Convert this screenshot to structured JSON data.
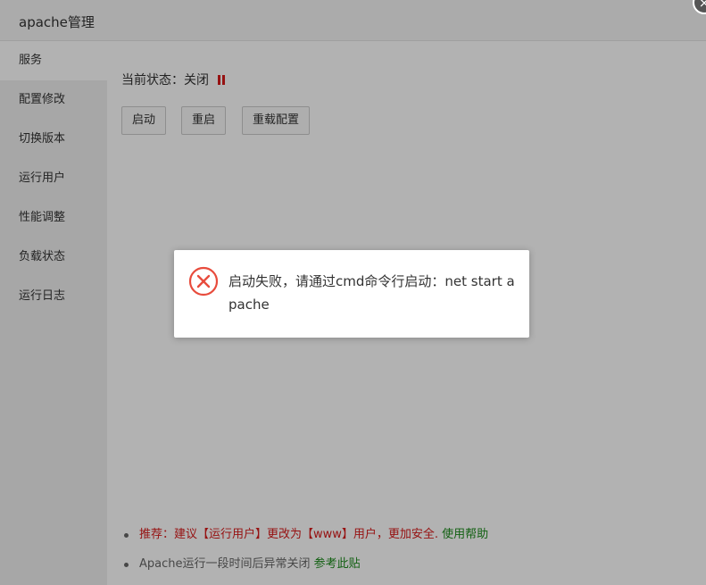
{
  "window": {
    "title": "apache管理",
    "close_symbol": "×"
  },
  "sidebar": {
    "items": [
      {
        "label": "服务",
        "active": true
      },
      {
        "label": "配置修改"
      },
      {
        "label": "切换版本"
      },
      {
        "label": "运行用户"
      },
      {
        "label": "性能调整"
      },
      {
        "label": "负载状态"
      },
      {
        "label": "运行日志"
      }
    ]
  },
  "status": {
    "label": "当前状态：",
    "value": "关闭",
    "icon": "pause-icon",
    "icon_color": "#d71b1b"
  },
  "buttons": {
    "start": "启动",
    "restart": "重启",
    "reload": "重载配置"
  },
  "tips": {
    "tip1_text": "推荐：建议【运行用户】更改为【www】用户，更加安全.",
    "tip1_link": "使用帮助",
    "tip2_text": "Apache运行一段时间后异常关闭",
    "tip2_link": "参考此贴"
  },
  "toast": {
    "message": "启动失败，请通过cmd命令行启动：net start apache",
    "icon": "error-circle-x-icon",
    "icon_color": "#e84c3d"
  }
}
